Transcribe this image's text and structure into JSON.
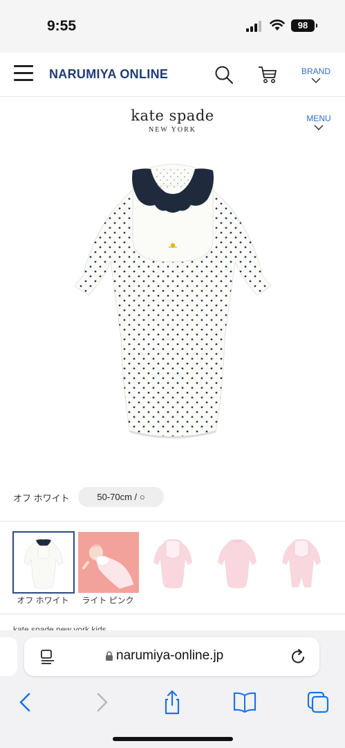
{
  "status": {
    "time": "9:55",
    "battery": "98"
  },
  "header": {
    "site_title": "NARUMIYA ONLINE",
    "brand_label": "BRAND"
  },
  "logo": {
    "line1": "kate spade",
    "line2": "NEW YORK"
  },
  "menu": {
    "label": "MENU"
  },
  "product": {
    "color_label": "オフ ホワイト",
    "size_label": "50-70cm / ○"
  },
  "thumbnails": [
    {
      "label": "オフ ホワイト",
      "selected": true
    },
    {
      "label": "ライト ピンク",
      "selected": false
    },
    {
      "label": "",
      "selected": false
    },
    {
      "label": "",
      "selected": false
    },
    {
      "label": "",
      "selected": false
    }
  ],
  "clipped_text": "kate spade new york kids",
  "browser": {
    "url": "narumiya-online.jp"
  },
  "colors": {
    "brand_navy": "#1f3b78",
    "link_blue": "#2a6fbf",
    "ios_blue": "#1a73e8"
  }
}
